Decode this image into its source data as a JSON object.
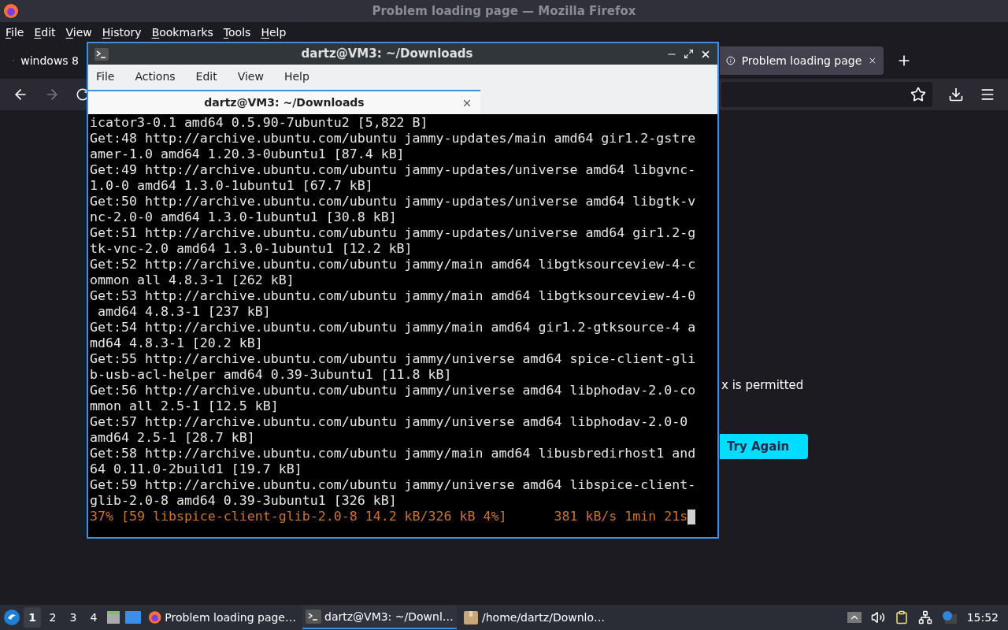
{
  "firefox": {
    "title": "Problem loading page — Mozilla Firefox",
    "menu": [
      "File",
      "Edit",
      "View",
      "History",
      "Bookmarks",
      "Tools",
      "Help"
    ],
    "tabs": [
      {
        "label": "windows 8",
        "selected": false
      },
      {
        "label": "Problem loading page",
        "selected": true
      }
    ],
    "message": "x is permitted",
    "button": "Try Again"
  },
  "terminal": {
    "title": "dartz@VM3: ~/Downloads",
    "menu": [
      "File",
      "Actions",
      "Edit",
      "View",
      "Help"
    ],
    "tab": "dartz@VM3: ~/Downloads",
    "lines": [
      {
        "kind": "output",
        "text": "icator3-0.1 amd64 0.5.90-7ubuntu2 [5,822 B]"
      },
      {
        "kind": "output",
        "text": "Get:48 http://archive.ubuntu.com/ubuntu jammy-updates/main amd64 gir1.2-gstre"
      },
      {
        "kind": "output",
        "text": "amer-1.0 amd64 1.20.3-0ubuntu1 [87.4 kB]"
      },
      {
        "kind": "output",
        "text": "Get:49 http://archive.ubuntu.com/ubuntu jammy-updates/universe amd64 libgvnc-"
      },
      {
        "kind": "output",
        "text": "1.0-0 amd64 1.3.0-1ubuntu1 [67.7 kB]"
      },
      {
        "kind": "output",
        "text": "Get:50 http://archive.ubuntu.com/ubuntu jammy-updates/universe amd64 libgtk-v"
      },
      {
        "kind": "output",
        "text": "nc-2.0-0 amd64 1.3.0-1ubuntu1 [30.8 kB]"
      },
      {
        "kind": "output",
        "text": "Get:51 http://archive.ubuntu.com/ubuntu jammy-updates/universe amd64 gir1.2-g"
      },
      {
        "kind": "output",
        "text": "tk-vnc-2.0 amd64 1.3.0-1ubuntu1 [12.2 kB]"
      },
      {
        "kind": "output",
        "text": "Get:52 http://archive.ubuntu.com/ubuntu jammy/main amd64 libgtksourceview-4-c"
      },
      {
        "kind": "output",
        "text": "ommon all 4.8.3-1 [262 kB]"
      },
      {
        "kind": "output",
        "text": "Get:53 http://archive.ubuntu.com/ubuntu jammy/main amd64 libgtksourceview-4-0"
      },
      {
        "kind": "output",
        "text": " amd64 4.8.3-1 [237 kB]"
      },
      {
        "kind": "output",
        "text": "Get:54 http://archive.ubuntu.com/ubuntu jammy/main amd64 gir1.2-gtksource-4 a"
      },
      {
        "kind": "output",
        "text": "md64 4.8.3-1 [20.2 kB]"
      },
      {
        "kind": "output",
        "text": "Get:55 http://archive.ubuntu.com/ubuntu jammy/universe amd64 spice-client-gli"
      },
      {
        "kind": "output",
        "text": "b-usb-acl-helper amd64 0.39-3ubuntu1 [11.8 kB]"
      },
      {
        "kind": "output",
        "text": "Get:56 http://archive.ubuntu.com/ubuntu jammy/universe amd64 libphodav-2.0-co"
      },
      {
        "kind": "output",
        "text": "mmon all 2.5-1 [12.5 kB]"
      },
      {
        "kind": "output",
        "text": "Get:57 http://archive.ubuntu.com/ubuntu jammy/universe amd64 libphodav-2.0-0"
      },
      {
        "kind": "output",
        "text": "amd64 2.5-1 [28.7 kB]"
      },
      {
        "kind": "output",
        "text": "Get:58 http://archive.ubuntu.com/ubuntu jammy/main amd64 libusbredirhost1 and"
      },
      {
        "kind": "output",
        "text": "64 0.11.0-2build1 [19.7 kB]"
      },
      {
        "kind": "output",
        "text": "Get:59 http://archive.ubuntu.com/ubuntu jammy/universe amd64 libspice-client-"
      },
      {
        "kind": "output",
        "text": "glib-2.0-8 amd64 0.39-3ubuntu1 [326 kB]"
      },
      {
        "kind": "progress",
        "text": "37% [59 libspice-client-glib-2.0-8 14.2 kB/326 kB 4%]      381 kB/s 1min 21s"
      }
    ]
  },
  "taskbar": {
    "workspaces": [
      {
        "label": "1",
        "selected": true
      },
      {
        "label": "2",
        "selected": false
      },
      {
        "label": "3",
        "selected": false
      },
      {
        "label": "4",
        "selected": false
      }
    ],
    "tasks": [
      {
        "kind": "browser",
        "label": "Problem loading page…",
        "selected": false
      },
      {
        "kind": "terminal",
        "label": "dartz@VM3: ~/Downl…",
        "selected": true
      },
      {
        "kind": "folder",
        "label": "/home/dartz/Downlo…",
        "selected": false
      }
    ],
    "clock": "15:52"
  }
}
